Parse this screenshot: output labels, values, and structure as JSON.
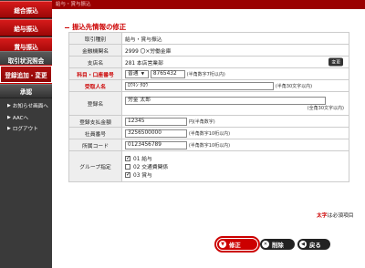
{
  "nav": {
    "items": [
      {
        "label": "総合振込"
      },
      {
        "label": "給与振込"
      },
      {
        "label": "賞与振込"
      },
      {
        "label": "取引状況照会"
      },
      {
        "label": "登録追加・変更"
      },
      {
        "label": "承認"
      }
    ],
    "subs": [
      {
        "label": "お知らせ画面へ"
      },
      {
        "label": "AACへ"
      },
      {
        "label": "ログアウト"
      }
    ]
  },
  "header": {
    "breadcrumb": "給与・賞与振込"
  },
  "section": {
    "title": "振込先情報の修正"
  },
  "form": {
    "rows": {
      "torihiki": {
        "label": "取引種別",
        "value": "給与・賞与振込"
      },
      "bank": {
        "label": "金融機関名",
        "value": "2999 〇×労働金庫"
      },
      "branch": {
        "label": "支店名",
        "value": "281 本店営業部",
        "change_btn": "変更"
      },
      "account": {
        "label": "科目・口座番号",
        "type": "普通",
        "number": "8765432",
        "note": "(半角数字7桁以内)"
      },
      "payee": {
        "label": "受取人名",
        "value": "ﾛｳｷﾝ ﾀﾛｳ",
        "note": "(半角30文字以内)"
      },
      "reg_name": {
        "label": "登録名",
        "value": "労金 太郎",
        "note": "(全角30文字以内)"
      },
      "amount": {
        "label": "登録支払金額",
        "value": "12345",
        "note": "円(半角数字)"
      },
      "employee": {
        "label": "社員番号",
        "value": "3256500000",
        "note": "(半角数字10桁以内)"
      },
      "dept": {
        "label": "所属コード",
        "value": "0123456789",
        "note": "(半角数字10桁以内)"
      },
      "group": {
        "label": "グループ指定",
        "options": [
          {
            "label": "01 給与",
            "checked": true
          },
          {
            "label": "02 交通費関係",
            "checked": false
          },
          {
            "label": "03 賞与",
            "checked": true
          }
        ]
      }
    },
    "required_note_red": "太字",
    "required_note_rest": "は必須項目"
  },
  "buttons": {
    "ok": "修正",
    "delete": "削除",
    "back": "戻る"
  }
}
